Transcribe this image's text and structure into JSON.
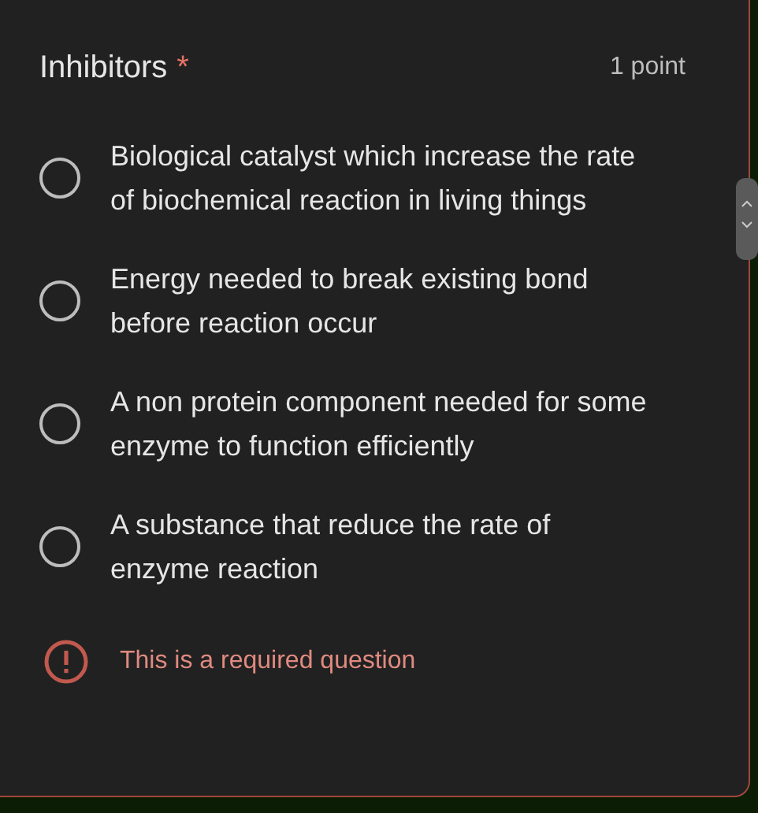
{
  "question": {
    "title": "Inhibitors",
    "required_mark": "*",
    "points": "1 point"
  },
  "options": [
    {
      "text": "Biological catalyst which increase the rate of biochemical reaction in living things",
      "selected": false
    },
    {
      "text": "Energy needed to break existing bond before reaction occur",
      "selected": false
    },
    {
      "text": "A non protein component needed for some enzyme to function efficiently",
      "selected": false
    },
    {
      "text": "A substance that reduce the rate of enzyme reaction",
      "selected": false
    }
  ],
  "error": {
    "text": "This is a required question"
  }
}
